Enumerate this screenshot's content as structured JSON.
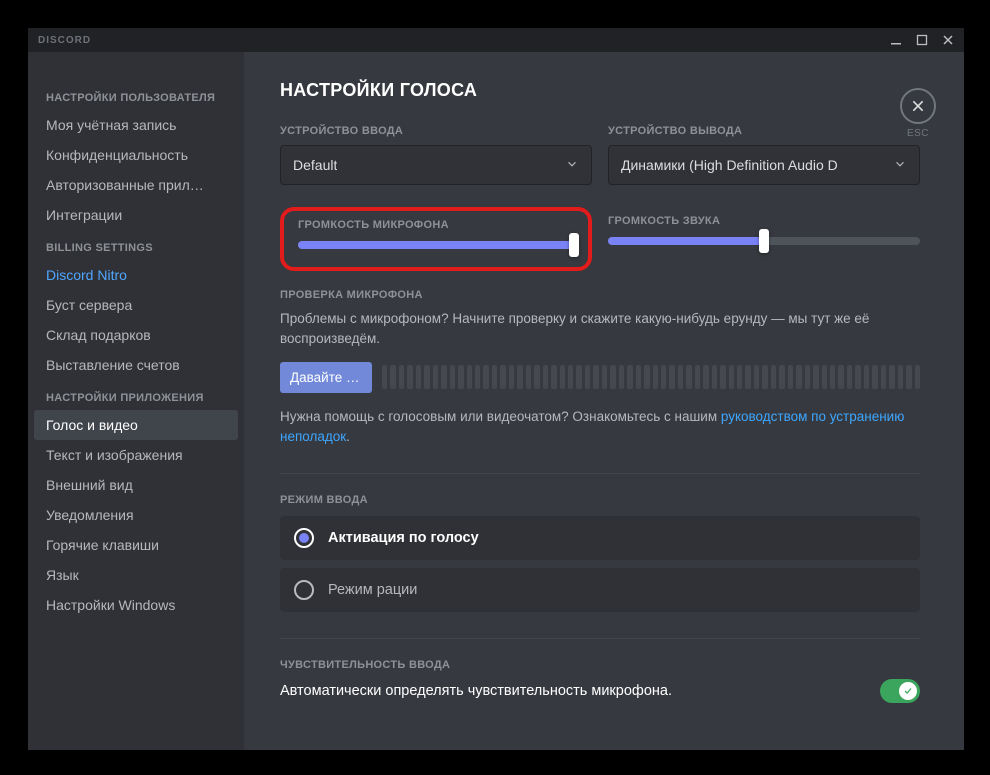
{
  "titlebar": {
    "brand": "DISCORD"
  },
  "close": {
    "esc_label": "ESC"
  },
  "sidebar": {
    "groups": [
      {
        "header": "НАСТРОЙКИ ПОЛЬЗОВАТЕЛЯ",
        "items": [
          {
            "label": "Моя учётная запись"
          },
          {
            "label": "Конфиденциальность"
          },
          {
            "label": "Авторизованные прил…"
          },
          {
            "label": "Интеграции"
          }
        ]
      },
      {
        "header": "BILLING SETTINGS",
        "items": [
          {
            "label": "Discord Nitro",
            "accent": true
          },
          {
            "label": "Буст сервера"
          },
          {
            "label": "Склад подарков"
          },
          {
            "label": "Выставление счетов"
          }
        ]
      },
      {
        "header": "НАСТРОЙКИ ПРИЛОЖЕНИЯ",
        "items": [
          {
            "label": "Голос и видео",
            "selected": true
          },
          {
            "label": "Текст и изображения"
          },
          {
            "label": "Внешний вид"
          },
          {
            "label": "Уведомления"
          },
          {
            "label": "Горячие клавиши"
          },
          {
            "label": "Язык"
          },
          {
            "label": "Настройки Windows"
          }
        ]
      }
    ]
  },
  "main": {
    "title": "НАСТРОЙКИ ГОЛОСА",
    "input_device_label": "УСТРОЙСТВО ВВОДА",
    "input_device_value": "Default",
    "output_device_label": "УСТРОЙСТВО ВЫВОДА",
    "output_device_value": "Динамики (High Definition Audio D",
    "mic_volume_label": "ГРОМКОСТЬ МИКРОФОНА",
    "mic_volume_percent": 100,
    "output_volume_label": "ГРОМКОСТЬ ЗВУКА",
    "output_volume_percent": 50,
    "mic_test_header": "ПРОВЕРКА МИКРОФОНА",
    "mic_test_text": "Проблемы с микрофоном? Начните проверку и скажите какую-нибудь ерунду — мы тут же её воспроизведём.",
    "mic_test_button": "Давайте пр…",
    "help_prefix": "Нужна помощь с голосовым или видеочатом? Ознакомьтесь с нашим ",
    "help_link": "руководством по устранению неполадок",
    "help_suffix": ".",
    "input_mode_label": "РЕЖИМ ВВОДА",
    "mode_voice": "Активация по голосу",
    "mode_ptt": "Режим рации",
    "sensitivity_label": "ЧУВСТВИТЕЛЬНОСТЬ ВВОДА",
    "auto_sensitivity": "Автоматически определять чувствительность микрофона."
  }
}
